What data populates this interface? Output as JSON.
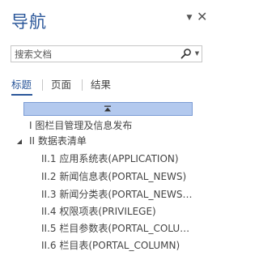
{
  "pane": {
    "title": "导航",
    "menu_icon": "triangle-down-icon",
    "close_icon": "close-icon"
  },
  "search": {
    "placeholder": "搜索文档",
    "value": "",
    "button_icon": "search-magnifier-icon",
    "dropdown_icon": "chevron-down-icon"
  },
  "tabs": [
    {
      "label": "标题",
      "active": true
    },
    {
      "label": "页面",
      "active": false
    },
    {
      "label": "结果",
      "active": false
    }
  ],
  "scroll_top_icon": "scroll-to-top-icon",
  "headings": [
    {
      "label": "I 图栏目管理及信息发布",
      "level": 1
    },
    {
      "label": "II 数据表清单",
      "level": 1,
      "expanded": true
    },
    {
      "label": "II.1 应用系统表(APPLICATION)",
      "level": 2
    },
    {
      "label": "II.2 新闻信息表(PORTAL_NEWS)",
      "level": 2
    },
    {
      "label": "II.3 新闻分类表(PORTAL_NEWS…",
      "level": 2
    },
    {
      "label": "II.4 权限项表(PRIVILEGE)",
      "level": 2
    },
    {
      "label": "II.5 栏目参数表(PORTAL_COLU…",
      "level": 2
    },
    {
      "label": "II.6 栏目表(PORTAL_COLUMN)",
      "level": 2
    }
  ],
  "colors": {
    "accent": "#2b579a",
    "highlight": "#b3c9ee",
    "highlight_border": "#7b9bd4",
    "text": "#444444"
  }
}
